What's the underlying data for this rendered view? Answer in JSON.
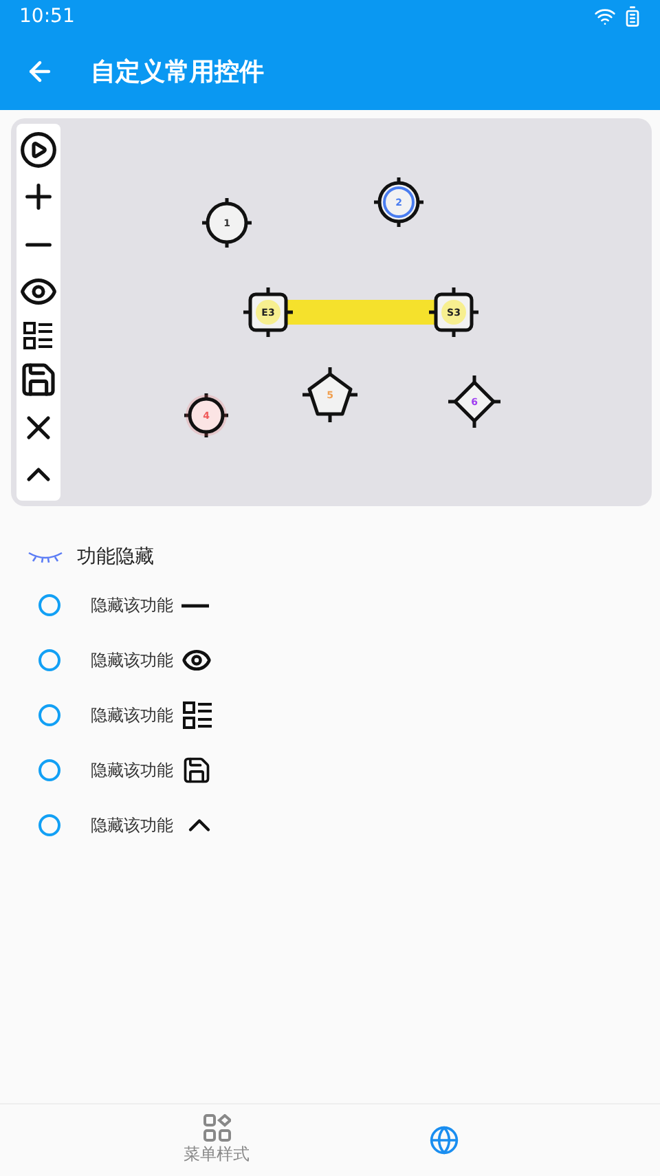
{
  "status_bar": {
    "time": "10:51"
  },
  "app_bar": {
    "title": "自定义常用控件"
  },
  "canvas": {
    "nodes": [
      {
        "label": "1",
        "kind": "circle",
        "color": "#333333"
      },
      {
        "label": "2",
        "kind": "ring",
        "color": "#4a7df0"
      },
      {
        "label": "E3",
        "kind": "square",
        "color": "#222222"
      },
      {
        "label": "S3",
        "kind": "square",
        "color": "#222222"
      },
      {
        "label": "4",
        "kind": "glow",
        "color": "#f05a5a"
      },
      {
        "label": "5",
        "kind": "pentagon",
        "color": "#f0a050"
      },
      {
        "label": "6",
        "kind": "diamond",
        "color": "#a040f0"
      }
    ]
  },
  "section": {
    "title": "功能隐藏"
  },
  "hide_options": [
    {
      "label": "隐藏该功能",
      "checked": false
    },
    {
      "label": "隐藏该功能",
      "checked": false
    },
    {
      "label": "隐藏该功能",
      "checked": false
    },
    {
      "label": "隐藏该功能",
      "checked": false
    },
    {
      "label": "隐藏该功能",
      "checked": false
    }
  ],
  "bottom_nav": [
    {
      "label": "菜单样式",
      "selected": false
    },
    {
      "selected": true
    }
  ]
}
